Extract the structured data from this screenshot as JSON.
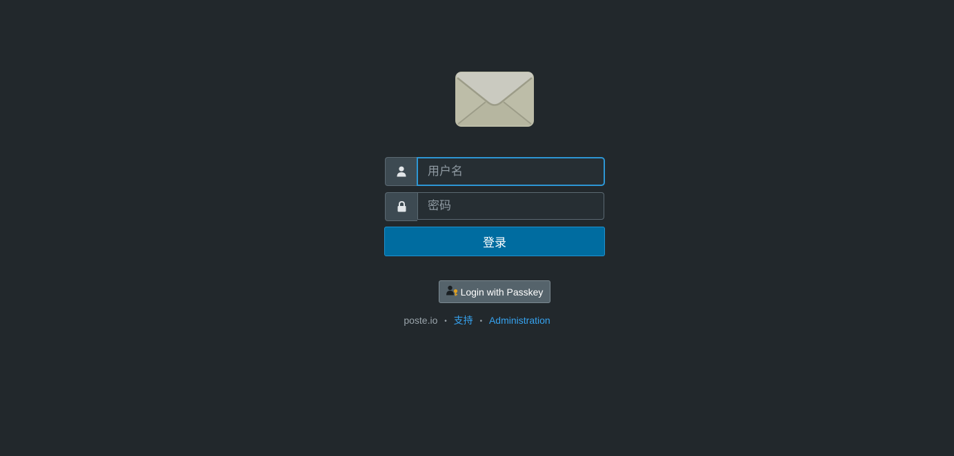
{
  "logo": {
    "icon": "envelope-icon"
  },
  "login_form": {
    "username": {
      "placeholder": "用户名",
      "value": "",
      "icon": "user-icon"
    },
    "password": {
      "placeholder": "密码",
      "value": "",
      "icon": "lock-icon"
    },
    "submit_label": "登录"
  },
  "passkey": {
    "label": "Login with Passkey",
    "icon": "user-key-icon"
  },
  "footer": {
    "brand": "poste.io",
    "separator": "•",
    "support_link": "支持",
    "admin_link": "Administration"
  },
  "colors": {
    "background": "#22282c",
    "primary": "#006ca0",
    "link": "#36a3f0"
  }
}
